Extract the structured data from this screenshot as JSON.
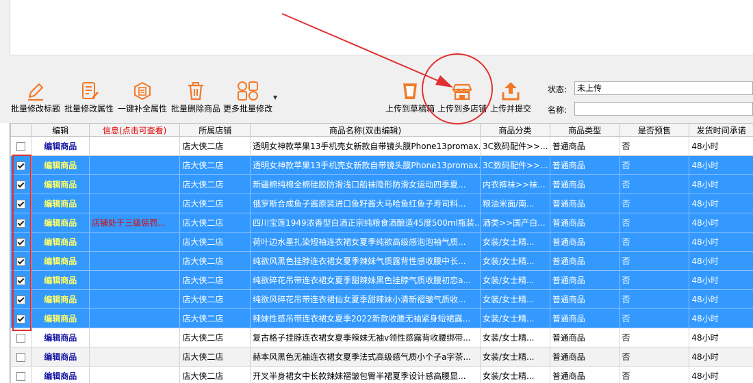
{
  "toolbar": {
    "buttons": [
      {
        "label": "批量修改标题",
        "icon": "pencil-icon"
      },
      {
        "label": "批量修改属性",
        "icon": "document-edit-icon"
      },
      {
        "label": "一键补全属性",
        "icon": "fill-property-icon"
      },
      {
        "label": "批量删除商品",
        "icon": "trash-icon"
      },
      {
        "label": "更多批量修改",
        "icon": "grid-icon"
      },
      {
        "label": "上传到草稿箱",
        "icon": "draft-bin-icon"
      },
      {
        "label": "上传到多店铺",
        "icon": "multi-store-icon"
      },
      {
        "label": "上传并提交",
        "icon": "upload-icon"
      }
    ],
    "status_label": "状态:",
    "status_value": "未上传",
    "name_label": "名称:",
    "name_value": ""
  },
  "table": {
    "headers": [
      "编辑",
      "信息(点击可查看)",
      "所属店铺",
      "商品名称(双击编辑)",
      "商品分类",
      "商品类型",
      "是否预售",
      "发货时间承诺"
    ],
    "rows": [
      {
        "checked": false,
        "selected": false,
        "edit": "编辑商品",
        "info": "",
        "shop": "店大侠二店",
        "name": "透明女神款苹果13手机壳女新款自带镜头膜Phone13promax...",
        "category": "3C数码配件>>...",
        "type": "普通商品",
        "presale": "否",
        "ship": "48小时"
      },
      {
        "checked": true,
        "selected": true,
        "edit": "编辑商品",
        "info": "",
        "shop": "店大侠二店",
        "name": "透明女神款苹果13手机壳女新款自带镜头膜Phone13promax...",
        "category": "3C数码配件>>...",
        "type": "普通商品",
        "presale": "否",
        "ship": "48小时"
      },
      {
        "checked": true,
        "selected": true,
        "edit": "编辑商品",
        "info": "",
        "shop": "店大侠二店",
        "name": "新疆棉纯棉全棉硅胶防滑浅口船袜隐形防滑女运动四季夏...",
        "category": "内衣裤袜>>袜...",
        "type": "普通商品",
        "presale": "否",
        "ship": "48小时"
      },
      {
        "checked": true,
        "selected": true,
        "edit": "编辑商品",
        "info": "",
        "shop": "店大侠二店",
        "name": "俄罗斯合成鱼子酱原装进口鱼籽酱大马哈鱼红鱼子寿司料...",
        "category": "粮油米面/南...",
        "type": "普通商品",
        "presale": "否",
        "ship": "48小时"
      },
      {
        "checked": true,
        "selected": true,
        "edit": "编辑商品",
        "info": "店铺处于三级惩罚...",
        "shop": "店大侠二店",
        "name": "四川宝莲1949浓香型白酒正宗纯粮食酒酿造45度500ml瓶装...",
        "category": "酒类>>国产白...",
        "type": "普通商品",
        "presale": "否",
        "ship": "48小时"
      },
      {
        "checked": true,
        "selected": true,
        "edit": "编辑商品",
        "info": "",
        "shop": "店大侠二店",
        "name": "荷叶边水墨扎染短袖连衣裙女夏季纯欲高级感泡泡袖气质...",
        "category": "女装/女士精...",
        "type": "普通商品",
        "presale": "否",
        "ship": "48小时"
      },
      {
        "checked": true,
        "selected": true,
        "edit": "编辑商品",
        "info": "",
        "shop": "店大侠二店",
        "name": "纯欲风黑色挂脖连衣裙女夏季辣妹气质露背性感收腰中长...",
        "category": "女装/女士精...",
        "type": "普通商品",
        "presale": "否",
        "ship": "48小时"
      },
      {
        "checked": true,
        "selected": true,
        "edit": "编辑商品",
        "info": "",
        "shop": "店大侠二店",
        "name": "纯欲碎花吊带连衣裙女夏季甜辣妹黑色挂脖气质收腰初恋a...",
        "category": "女装/女士精...",
        "type": "普通商品",
        "presale": "否",
        "ship": "48小时"
      },
      {
        "checked": true,
        "selected": true,
        "edit": "编辑商品",
        "info": "",
        "shop": "店大侠二店",
        "name": "纯欲风碎花吊带连衣裙仙女夏季甜辣妹小清新褶皱气质收...",
        "category": "女装/女士精...",
        "type": "普通商品",
        "presale": "否",
        "ship": "48小时"
      },
      {
        "checked": true,
        "selected": true,
        "edit": "编辑商品",
        "info": "",
        "shop": "店大侠二店",
        "name": "辣妹性感吊带连衣裙女夏季2022新款收腰无袖紧身短裙露...",
        "category": "女装/女士精...",
        "type": "普通商品",
        "presale": "否",
        "ship": "48小时"
      },
      {
        "checked": false,
        "selected": false,
        "edit": "编辑商品",
        "info": "",
        "shop": "店大侠二店",
        "name": "复古格子挂脖连衣裙女夏季辣妹无袖v领性感露背收腰绑带...",
        "category": "女装/女士精...",
        "type": "普通商品",
        "presale": "否",
        "ship": "48小时"
      },
      {
        "checked": false,
        "selected": false,
        "edit": "编辑商品",
        "info": "",
        "shop": "店大侠二店",
        "name": "赫本风黑色无袖连衣裙女夏季法式高级感气质小个子a字茶...",
        "category": "女装/女士精...",
        "type": "普通商品",
        "presale": "否",
        "ship": "48小时"
      },
      {
        "checked": false,
        "selected": false,
        "edit": "编辑商品",
        "info": "",
        "shop": "店大侠二店",
        "name": "开叉半身裙女中长款辣妹褶皱包臀半裙夏季设计感高腰显...",
        "category": "女装/女士精...",
        "type": "普通商品",
        "presale": "否",
        "ship": "48小时"
      }
    ]
  },
  "colors": {
    "selection": "#3399ff",
    "annotation": "#e03030",
    "icon_orange": "#f07a28"
  }
}
